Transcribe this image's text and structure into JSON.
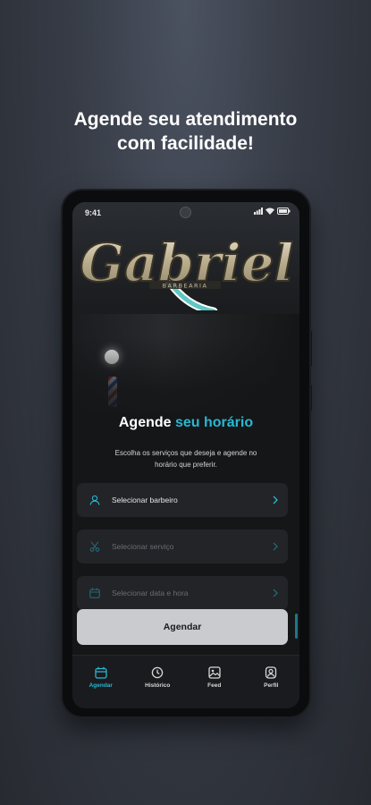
{
  "headline": {
    "line1": "Agende seu atendimento",
    "line2": "com facilidade!"
  },
  "status_bar": {
    "time": "9:41",
    "icons": [
      "signal-icon",
      "wifi-icon",
      "battery-icon"
    ]
  },
  "hero": {
    "logo_text": "Gabriel",
    "logo_subtext": "BARBEARIA"
  },
  "main": {
    "title_part1": "Agende",
    "title_part2": "seu horário",
    "subtitle_line1": "Escolha os serviços que deseja e agende no",
    "subtitle_line2": "horário que preferir.",
    "fields": [
      {
        "label": "Selecionar barbeiro",
        "icon": "user-icon",
        "enabled": true
      },
      {
        "label": "Selecionar serviço",
        "icon": "scissors-icon",
        "enabled": false
      },
      {
        "label": "Selecionar data e hora",
        "icon": "calendar-icon",
        "enabled": false
      }
    ],
    "submit_label": "Agendar"
  },
  "navbar": {
    "items": [
      {
        "label": "Agendar",
        "icon": "calendar-icon",
        "active": true
      },
      {
        "label": "Histórico",
        "icon": "history-icon",
        "active": false
      },
      {
        "label": "Feed",
        "icon": "image-icon",
        "active": false
      },
      {
        "label": "Perfil",
        "icon": "profile-icon",
        "active": false
      }
    ]
  },
  "colors": {
    "accent": "#27b8d3",
    "background": "#151618",
    "field_bg": "#222427",
    "button_bg": "#c9cbcf"
  }
}
